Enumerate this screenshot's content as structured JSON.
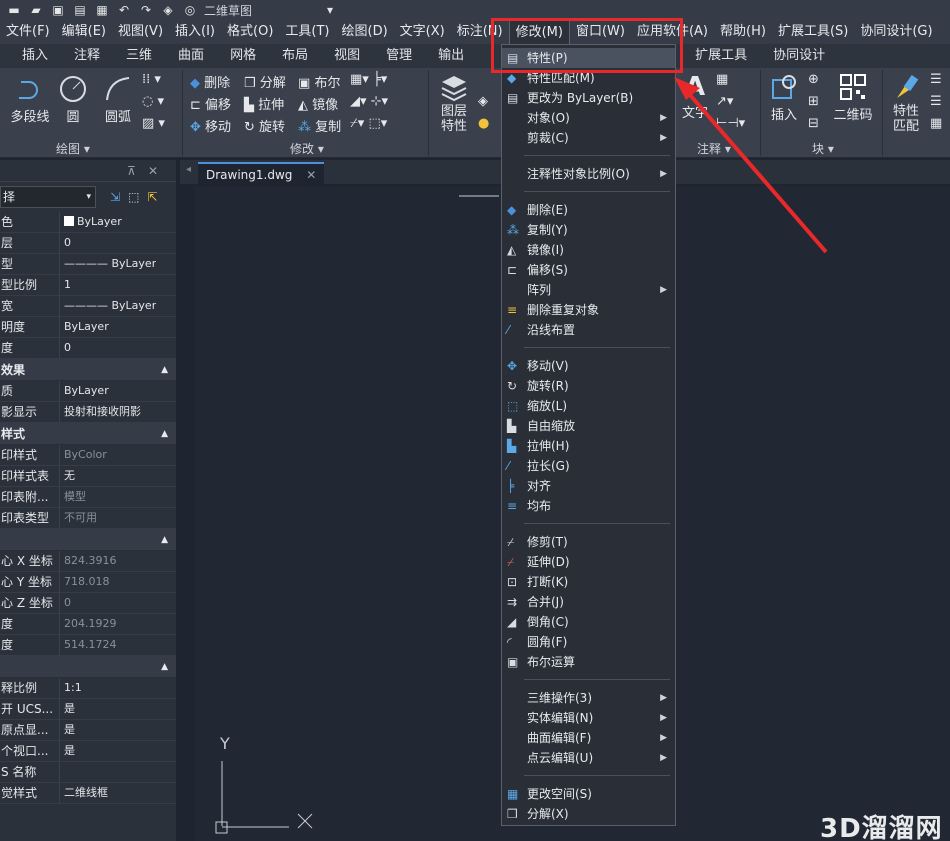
{
  "title_bar": {
    "app_title": "二维草图"
  },
  "menubar": [
    "文件(F)",
    "编辑(E)",
    "视图(V)",
    "插入(I)",
    "格式(O)",
    "工具(T)",
    "绘图(D)",
    "文字(X)",
    "标注(N)",
    "修改(M)",
    "窗口(W)",
    "应用软件(A)",
    "帮助(H)",
    "扩展工具(S)",
    "协同设计(G)"
  ],
  "ribbon_tabs": [
    "插入",
    "注释",
    "三维",
    "曲面",
    "网格",
    "布局",
    "视图",
    "管理",
    "输出",
    "扩展工具",
    "协同设计"
  ],
  "ribbon": {
    "draw_tools": [
      "多段线",
      "圆",
      "圆弧"
    ],
    "draw_panel": "绘图",
    "modify_tools": [
      "删除",
      "分解",
      "布尔",
      "偏移",
      "拉伸",
      "镜像",
      "移动",
      "旋转",
      "复制"
    ],
    "modify_panel": "修改",
    "layer_tool": "图层\n特性",
    "text_tool": "文字",
    "annotate_panel": "注释",
    "insert_tool": "插入",
    "block_panel": "块",
    "qr_tool": "二维码",
    "match_tool": "特性\n匹配"
  },
  "palette": {
    "filter_label": "择",
    "groups": [
      {
        "title": null,
        "rows": [
          {
            "key": "色",
            "value": "ByLayer",
            "swatch": true
          },
          {
            "key": "层",
            "value": "0"
          },
          {
            "key": "型",
            "value": "———— ByLayer"
          },
          {
            "key": "型比例",
            "value": "1"
          },
          {
            "key": "宽",
            "value": "———— ByLayer"
          },
          {
            "key": "明度",
            "value": "ByLayer"
          },
          {
            "key": "度",
            "value": "0"
          }
        ]
      },
      {
        "title": "效果",
        "rows": [
          {
            "key": "质",
            "value": "ByLayer"
          },
          {
            "key": "影显示",
            "value": "投射和接收阴影"
          }
        ]
      },
      {
        "title": "样式",
        "rows": [
          {
            "key": "印样式",
            "value": "ByColor",
            "dim": true
          },
          {
            "key": "印样式表",
            "value": "无"
          },
          {
            "key": "印表附...",
            "value": "模型",
            "dim": true
          },
          {
            "key": "印表类型",
            "value": "不可用",
            "dim": true
          }
        ]
      },
      {
        "title": "",
        "rows": [
          {
            "key": "心 X 坐标",
            "value": "824.3916",
            "dim": true
          },
          {
            "key": "心 Y 坐标",
            "value": "718.018",
            "dim": true
          },
          {
            "key": "心 Z 坐标",
            "value": "0",
            "dim": true
          },
          {
            "key": "度",
            "value": "204.1929",
            "dim": true
          },
          {
            "key": "度",
            "value": "514.1724",
            "dim": true
          }
        ]
      },
      {
        "title": "",
        "rows": [
          {
            "key": "释比例",
            "value": "1:1"
          },
          {
            "key": "开 UCS...",
            "value": "是"
          },
          {
            "key": "原点显...",
            "value": "是"
          },
          {
            "key": "个视口...",
            "value": "是"
          },
          {
            "key": "S 名称",
            "value": ""
          },
          {
            "key": "觉样式",
            "value": "二维线框"
          }
        ]
      }
    ]
  },
  "document_tab": "Drawing1.dwg",
  "dropdown": {
    "groups": [
      [
        {
          "label": "特性(P)",
          "icon": "properties-icon",
          "highlight": true
        },
        {
          "label": "特性匹配(M)",
          "icon": "match-properties-icon"
        },
        {
          "label": "更改为 ByLayer(B)",
          "icon": "bylayer-icon"
        },
        {
          "label": "对象(O)",
          "submenu": true
        },
        {
          "label": "剪裁(C)",
          "submenu": true
        }
      ],
      [
        {
          "label": "注释性对象比例(O)",
          "submenu": true
        }
      ],
      [
        {
          "label": "删除(E)",
          "icon": "erase-icon"
        },
        {
          "label": "复制(Y)",
          "icon": "copy-icon"
        },
        {
          "label": "镜像(I)",
          "icon": "mirror-icon"
        },
        {
          "label": "偏移(S)",
          "icon": "offset-icon"
        },
        {
          "label": "阵列",
          "submenu": true
        },
        {
          "label": "删除重复对象",
          "icon": "overkill-icon"
        },
        {
          "label": "沿线布置",
          "icon": "measure-icon"
        }
      ],
      [
        {
          "label": "移动(V)",
          "icon": "move-icon"
        },
        {
          "label": "旋转(R)",
          "icon": "rotate-icon"
        },
        {
          "label": "缩放(L)",
          "icon": "scale-icon"
        },
        {
          "label": "自由缩放",
          "icon": "free-scale-icon"
        },
        {
          "label": "拉伸(H)",
          "icon": "stretch-icon"
        },
        {
          "label": "拉长(G)",
          "icon": "lengthen-icon"
        },
        {
          "label": "对齐",
          "icon": "align-icon"
        },
        {
          "label": "均布",
          "icon": "distribute-icon"
        }
      ],
      [
        {
          "label": "修剪(T)",
          "icon": "trim-icon"
        },
        {
          "label": "延伸(D)",
          "icon": "extend-icon"
        },
        {
          "label": "打断(K)",
          "icon": "break-icon"
        },
        {
          "label": "合并(J)",
          "icon": "join-icon"
        },
        {
          "label": "倒角(C)",
          "icon": "chamfer-icon"
        },
        {
          "label": "圆角(F)",
          "icon": "fillet-icon"
        },
        {
          "label": "布尔运算",
          "icon": "boolean-icon"
        }
      ],
      [
        {
          "label": "三维操作(3)",
          "submenu": true
        },
        {
          "label": "实体编辑(N)",
          "submenu": true
        },
        {
          "label": "曲面编辑(F)",
          "submenu": true
        },
        {
          "label": "点云编辑(U)",
          "submenu": true
        }
      ],
      [
        {
          "label": "更改空间(S)",
          "icon": "change-space-icon"
        },
        {
          "label": "分解(X)",
          "icon": "explode-icon"
        }
      ]
    ]
  },
  "ucs": {
    "y_label": "Y"
  },
  "watermark": "3D溜溜网",
  "colors": {
    "highlight_box": "#e8282a",
    "arrow": "#e8282a"
  }
}
